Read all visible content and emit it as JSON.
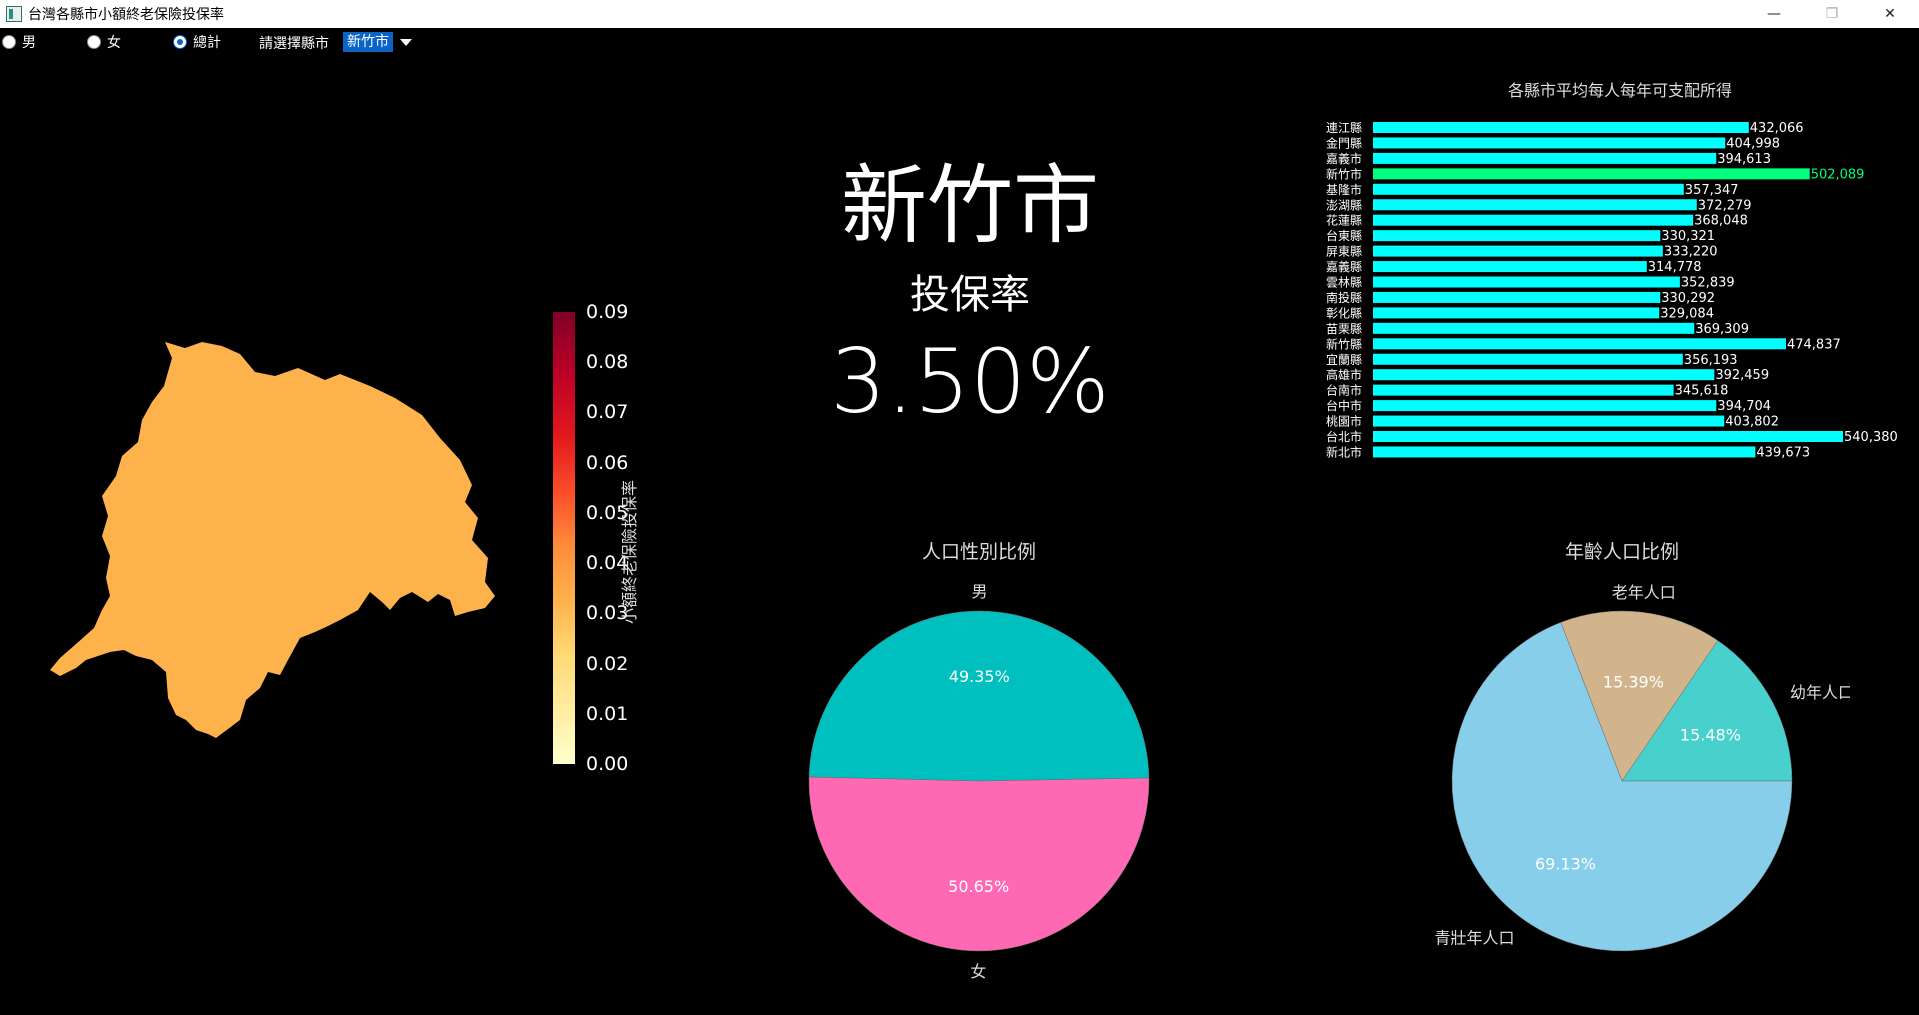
{
  "window": {
    "title": "台灣各縣市小額終老保險投保率",
    "minimize": "—",
    "maximize": "❐",
    "close": "✕"
  },
  "toolbar": {
    "radios": [
      {
        "label": "男",
        "checked": false
      },
      {
        "label": "女",
        "checked": false
      },
      {
        "label": "總計",
        "checked": true
      }
    ],
    "city_label": "請選擇縣市",
    "city_selected": "新竹市"
  },
  "map": {
    "fill_color": "#feb24c",
    "colorbar_label": "小額終老保險投保率",
    "colorbar_ticks": [
      "0.09",
      "0.08",
      "0.07",
      "0.06",
      "0.05",
      "0.04",
      "0.03",
      "0.02",
      "0.01",
      "0.00"
    ],
    "colorbar_range": [
      0.0,
      0.09
    ]
  },
  "summary": {
    "city": "新竹市",
    "rate_label": "投保率",
    "rate_value": "3.50%"
  },
  "chart_data": [
    {
      "type": "bar",
      "orientation": "horizontal",
      "title": "各縣市平均每人每年可支配所得",
      "highlight": "新竹市",
      "bar_color": "#00ffff",
      "highlight_color": "#00ff7f",
      "categories": [
        "連江縣",
        "金門縣",
        "嘉義市",
        "新竹市",
        "基隆市",
        "澎湖縣",
        "花蓮縣",
        "台東縣",
        "屏東縣",
        "嘉義縣",
        "雲林縣",
        "南投縣",
        "彰化縣",
        "苗栗縣",
        "新竹縣",
        "宜蘭縣",
        "高雄市",
        "台南市",
        "台中市",
        "桃園市",
        "台北市",
        "新北市"
      ],
      "values": [
        432066,
        404998,
        394613,
        502089,
        357347,
        372279,
        368048,
        330321,
        333220,
        314778,
        352839,
        330292,
        329084,
        369309,
        474837,
        356193,
        392459,
        345618,
        394704,
        403802,
        540380,
        439673
      ],
      "value_labels": [
        "432,066",
        "404,998",
        "394,613",
        "502,089",
        "357,347",
        "372,279",
        "368,048",
        "330,321",
        "333,220",
        "314,778",
        "352,839",
        "330,292",
        "329,084",
        "369,309",
        "474,837",
        "356,193",
        "392,459",
        "345,618",
        "394,704",
        "403,802",
        "540,380",
        "439,673"
      ]
    },
    {
      "type": "pie",
      "title": "人口性別比例",
      "labels": [
        "男",
        "女"
      ],
      "values": [
        49.35,
        50.65
      ],
      "pct_labels": [
        "49.35%",
        "50.65%"
      ],
      "colors": [
        "#00bfbf",
        "#ff69b4"
      ]
    },
    {
      "type": "pie",
      "title": "年齡人口比例",
      "labels": [
        "幼年人口",
        "老年人口",
        "青壯年人口"
      ],
      "values": [
        15.48,
        15.39,
        69.13
      ],
      "pct_labels": [
        "15.48%",
        "15.39%",
        "69.13%"
      ],
      "colors": [
        "#48d1cc",
        "#d2b48c",
        "#87ceeb"
      ]
    }
  ]
}
